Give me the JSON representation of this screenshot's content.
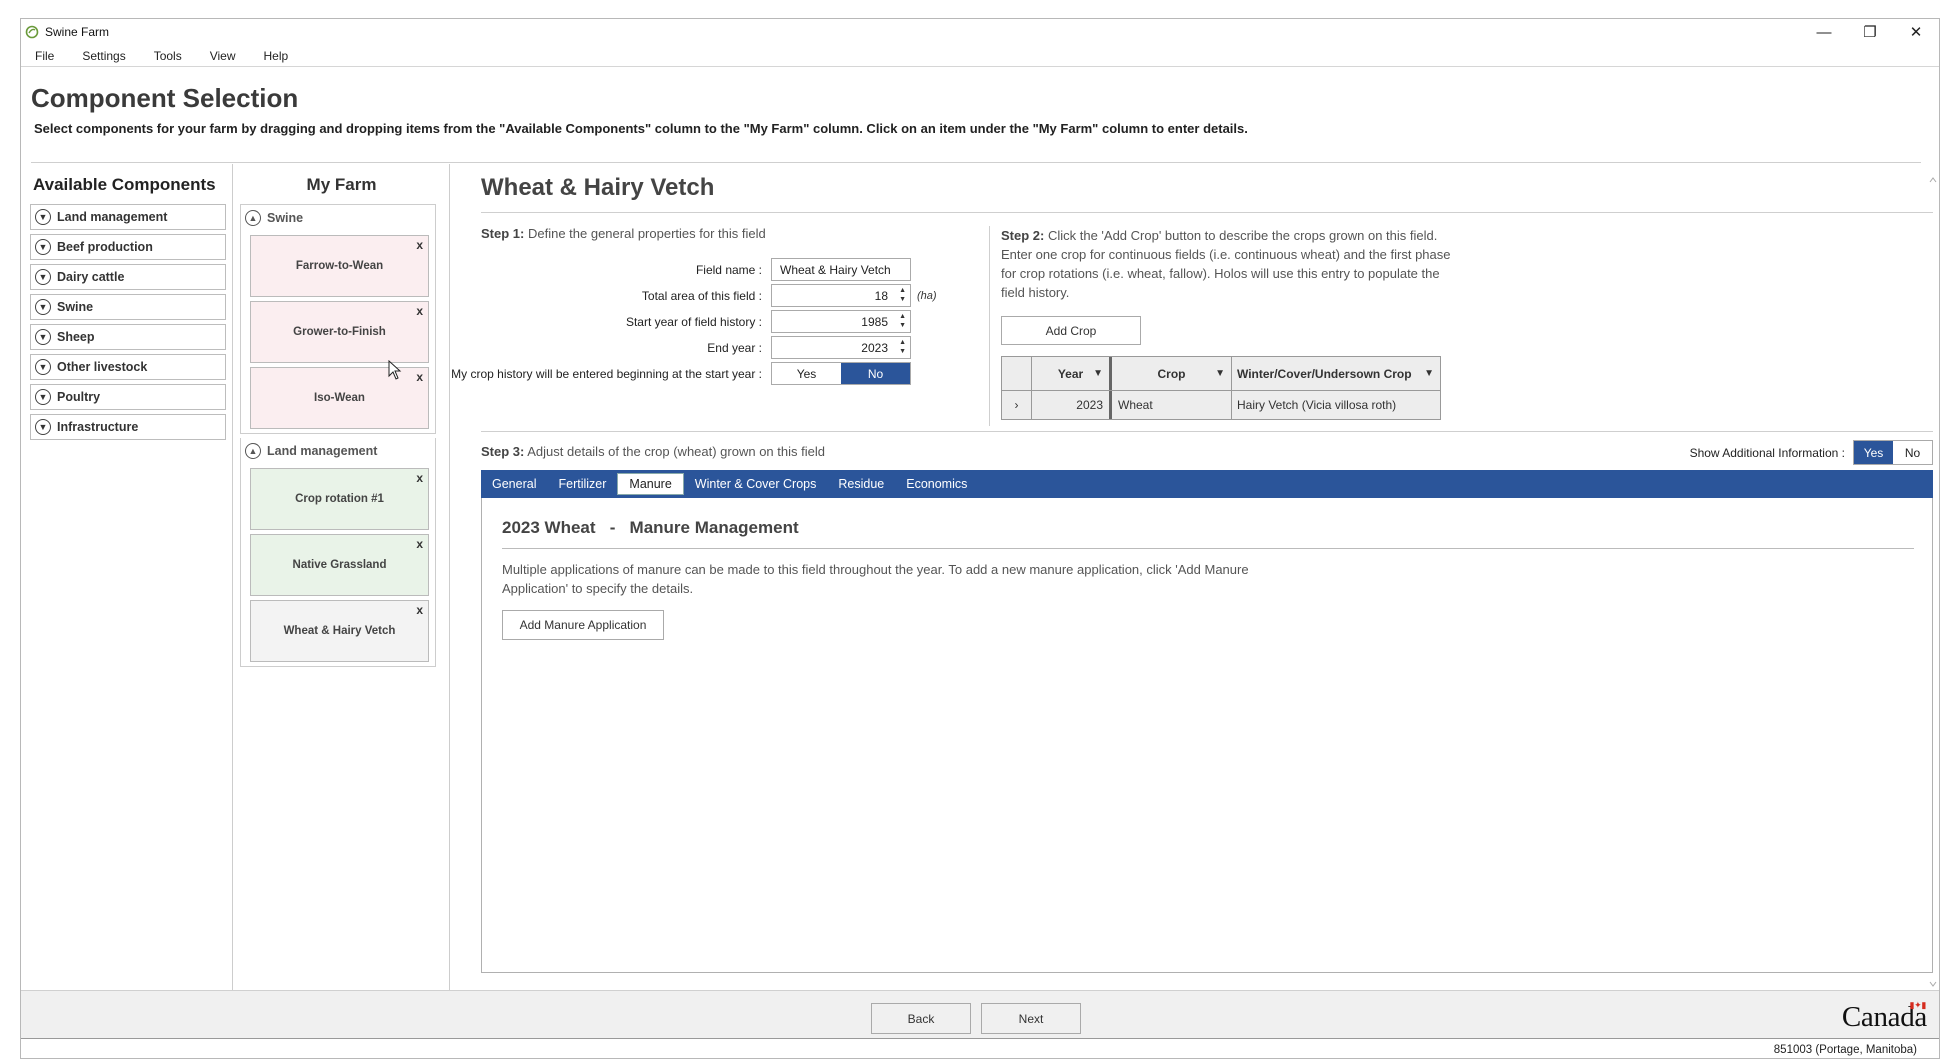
{
  "window": {
    "title": "Swine Farm",
    "controls": {
      "minimize": "—",
      "maximize": "❐",
      "close": "✕"
    }
  },
  "menu": [
    "File",
    "Settings",
    "Tools",
    "View",
    "Help"
  ],
  "header": {
    "title": "Component Selection",
    "subtitle": "Select components for your farm by dragging and dropping items from the \"Available Components\" column to the \"My Farm\" column. Click on an item under the \"My Farm\" column to enter details."
  },
  "available": {
    "title": "Available Components",
    "items": [
      "Land management",
      "Beef production",
      "Dairy cattle",
      "Swine",
      "Sheep",
      "Other livestock",
      "Poultry",
      "Infrastructure"
    ]
  },
  "myfarm": {
    "title": "My Farm",
    "groups": [
      {
        "label": "Swine",
        "items": [
          "Farrow-to-Wean",
          "Grower-to-Finish",
          "Iso-Wean"
        ]
      },
      {
        "label": "Land management",
        "items": [
          "Crop rotation #1",
          "Native Grassland",
          "Wheat & Hairy Vetch"
        ]
      }
    ],
    "remove_glyph": "x"
  },
  "detail": {
    "title": "Wheat & Hairy Vetch",
    "step1": {
      "label": "Step 1:",
      "text": "Define the general properties for this field",
      "field_name_label": "Field name :",
      "field_name_value": "Wheat & Hairy Vetch",
      "area_label": "Total area of this field :",
      "area_value": "18",
      "area_unit": "(ha)",
      "start_label": "Start year of field history :",
      "start_value": "1985",
      "end_label": "End year :",
      "end_value": "2023",
      "history_label": "My crop history will be entered beginning at the start year :",
      "yes": "Yes",
      "no": "No"
    },
    "step2": {
      "label": "Step 2:",
      "text": "Click the 'Add Crop' button to describe the crops grown on this field. Enter one crop for continuous fields (i.e. continuous wheat) and the first phase for crop rotations (i.e. wheat, fallow). Holos will use this entry to populate the field history.",
      "add_crop": "Add Crop",
      "columns": [
        "Year",
        "Crop",
        "Winter/Cover/Undersown Crop"
      ],
      "rows": [
        {
          "year": "2023",
          "crop": "Wheat",
          "cover": "Hairy Vetch (Vicia villosa roth)"
        }
      ]
    },
    "step3": {
      "label": "Step 3:",
      "text": "Adjust details of the crop (wheat) grown on this field",
      "show_additional_label": "Show Additional Information :",
      "yes": "Yes",
      "no": "No",
      "tabs": [
        "General",
        "Fertilizer",
        "Manure",
        "Winter & Cover Crops",
        "Residue",
        "Economics"
      ],
      "active_tab": "Manure",
      "panel_title": "2023 Wheat   -   Manure Management",
      "panel_text": "Multiple applications of manure can be made to this field throughout the year. To add a new manure application, click 'Add Manure Application' to specify the details.",
      "add_manure": "Add Manure Application"
    }
  },
  "footer": {
    "back": "Back",
    "next": "Next",
    "logo": "Canada"
  },
  "status": "851003 (Portage, Manitoba)",
  "colors": {
    "accent": "#2b559a",
    "swine_card": "#fbeef0",
    "land_card": "#e9f3e8"
  }
}
